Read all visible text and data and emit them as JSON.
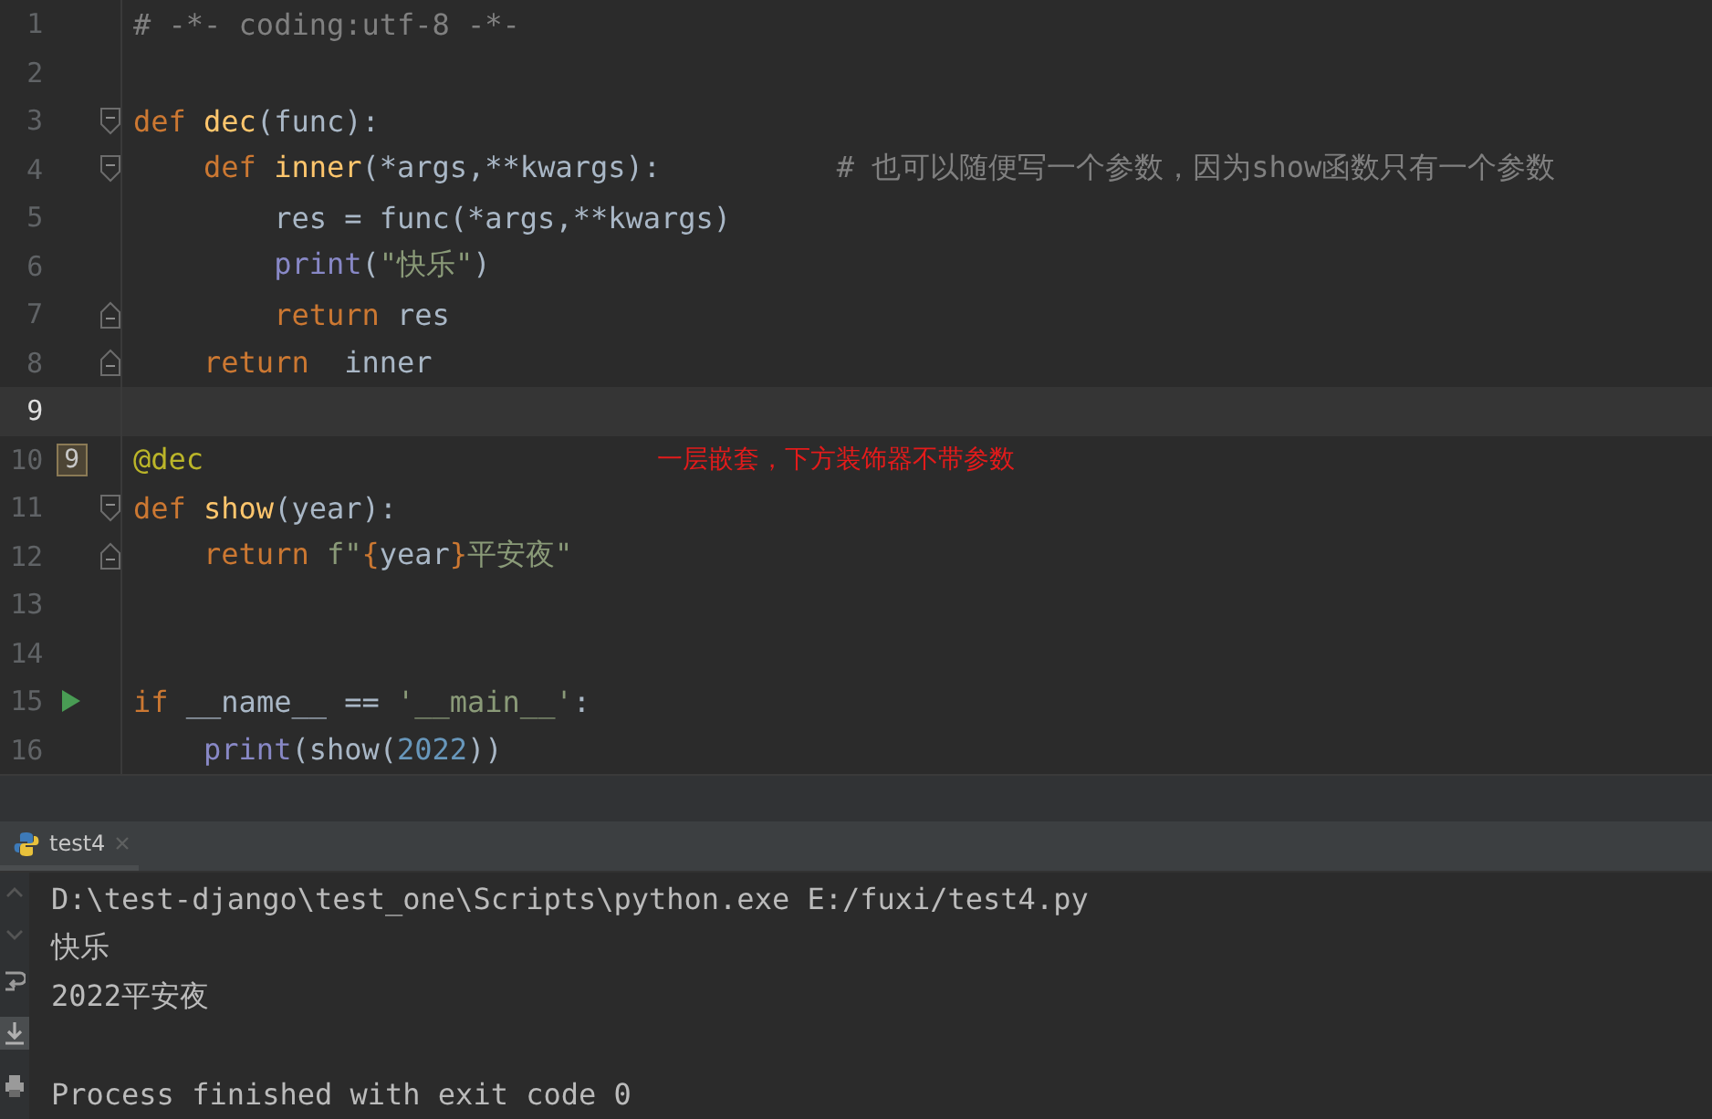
{
  "editor": {
    "lines": [
      {
        "number": "1",
        "current": false,
        "tokens": [
          {
            "kind": "comment",
            "text": "# -*- coding:utf-8 -*-"
          }
        ]
      },
      {
        "number": "2",
        "current": false
      },
      {
        "number": "3",
        "current": false,
        "fold_marker": {
          "kind": "start"
        },
        "tokens": [
          {
            "kind": "keyword",
            "text": "def "
          },
          {
            "kind": "func",
            "text": "dec"
          },
          {
            "kind": "plain",
            "text": "(func):"
          }
        ]
      },
      {
        "number": "4",
        "current": false,
        "fold_marker": {
          "kind": "start"
        },
        "tokens": [
          {
            "kind": "keyword",
            "text": "    def "
          },
          {
            "kind": "func",
            "text": "inner"
          },
          {
            "kind": "plain",
            "text": "(*args,**kwargs):          "
          },
          {
            "kind": "comment",
            "text": "# 也可以随便写一个参数，因为show函数只有一个参数"
          }
        ]
      },
      {
        "number": "5",
        "current": false,
        "tokens": [
          {
            "kind": "plain",
            "text": "        res = func(*args,**kwargs)"
          }
        ]
      },
      {
        "number": "6",
        "current": false,
        "tokens": [
          {
            "kind": "builtin",
            "text": "        print"
          },
          {
            "kind": "plain",
            "text": "("
          },
          {
            "kind": "string",
            "text": "\"快乐\""
          },
          {
            "kind": "plain",
            "text": ")"
          }
        ]
      },
      {
        "number": "7",
        "current": false,
        "fold_marker": {
          "kind": "end"
        },
        "tokens": [
          {
            "kind": "keyword",
            "text": "        return "
          },
          {
            "kind": "plain",
            "text": "res"
          }
        ]
      },
      {
        "number": "8",
        "current": false,
        "fold_marker": {
          "kind": "end"
        },
        "tokens": [
          {
            "kind": "keyword",
            "text": "    return  "
          },
          {
            "kind": "plain",
            "text": "inner"
          }
        ]
      },
      {
        "number": "9",
        "current": true
      },
      {
        "number": "10",
        "current": false,
        "marker": {
          "kind": "bookmark",
          "label": "9"
        },
        "note": "一层嵌套，下方装饰器不带参数",
        "tokens": [
          {
            "kind": "decorator",
            "text": "@dec"
          }
        ]
      },
      {
        "number": "11",
        "current": false,
        "fold_marker": {
          "kind": "start"
        },
        "tokens": [
          {
            "kind": "keyword",
            "text": "def "
          },
          {
            "kind": "func",
            "text": "show"
          },
          {
            "kind": "plain",
            "text": "(year):"
          }
        ]
      },
      {
        "number": "12",
        "current": false,
        "fold_marker": {
          "kind": "end"
        },
        "tokens": [
          {
            "kind": "keyword",
            "text": "    return "
          },
          {
            "kind": "string",
            "text": "f\""
          },
          {
            "kind": "keyword",
            "text": "{"
          },
          {
            "kind": "plain",
            "text": "year"
          },
          {
            "kind": "keyword",
            "text": "}"
          },
          {
            "kind": "string",
            "text": "平安夜\""
          }
        ]
      },
      {
        "number": "13",
        "current": false
      },
      {
        "number": "14",
        "current": false
      },
      {
        "number": "15",
        "current": false,
        "marker": {
          "kind": "run"
        },
        "tokens": [
          {
            "kind": "keyword",
            "text": "if "
          },
          {
            "kind": "plain",
            "text": "__name__ == "
          },
          {
            "kind": "string",
            "text": "'__main__'"
          },
          {
            "kind": "plain",
            "text": ":"
          }
        ]
      },
      {
        "number": "16",
        "current": false,
        "tokens": [
          {
            "kind": "builtin",
            "text": "    print"
          },
          {
            "kind": "plain",
            "text": "(show("
          },
          {
            "kind": "number",
            "text": "2022"
          },
          {
            "kind": "plain",
            "text": "))"
          }
        ]
      }
    ]
  },
  "run_panel": {
    "tabs": [
      {
        "label": "test4",
        "selected": true
      }
    ],
    "output": [
      {
        "kind": "stdout",
        "text": "D:\\test-django\\test_one\\Scripts\\python.exe E:/fuxi/test4.py"
      },
      {
        "kind": "stdout",
        "text": "快乐"
      },
      {
        "kind": "stdout",
        "text": "2022平安夜"
      },
      {
        "kind": "exit",
        "text": "Process finished with exit code 0"
      }
    ]
  }
}
